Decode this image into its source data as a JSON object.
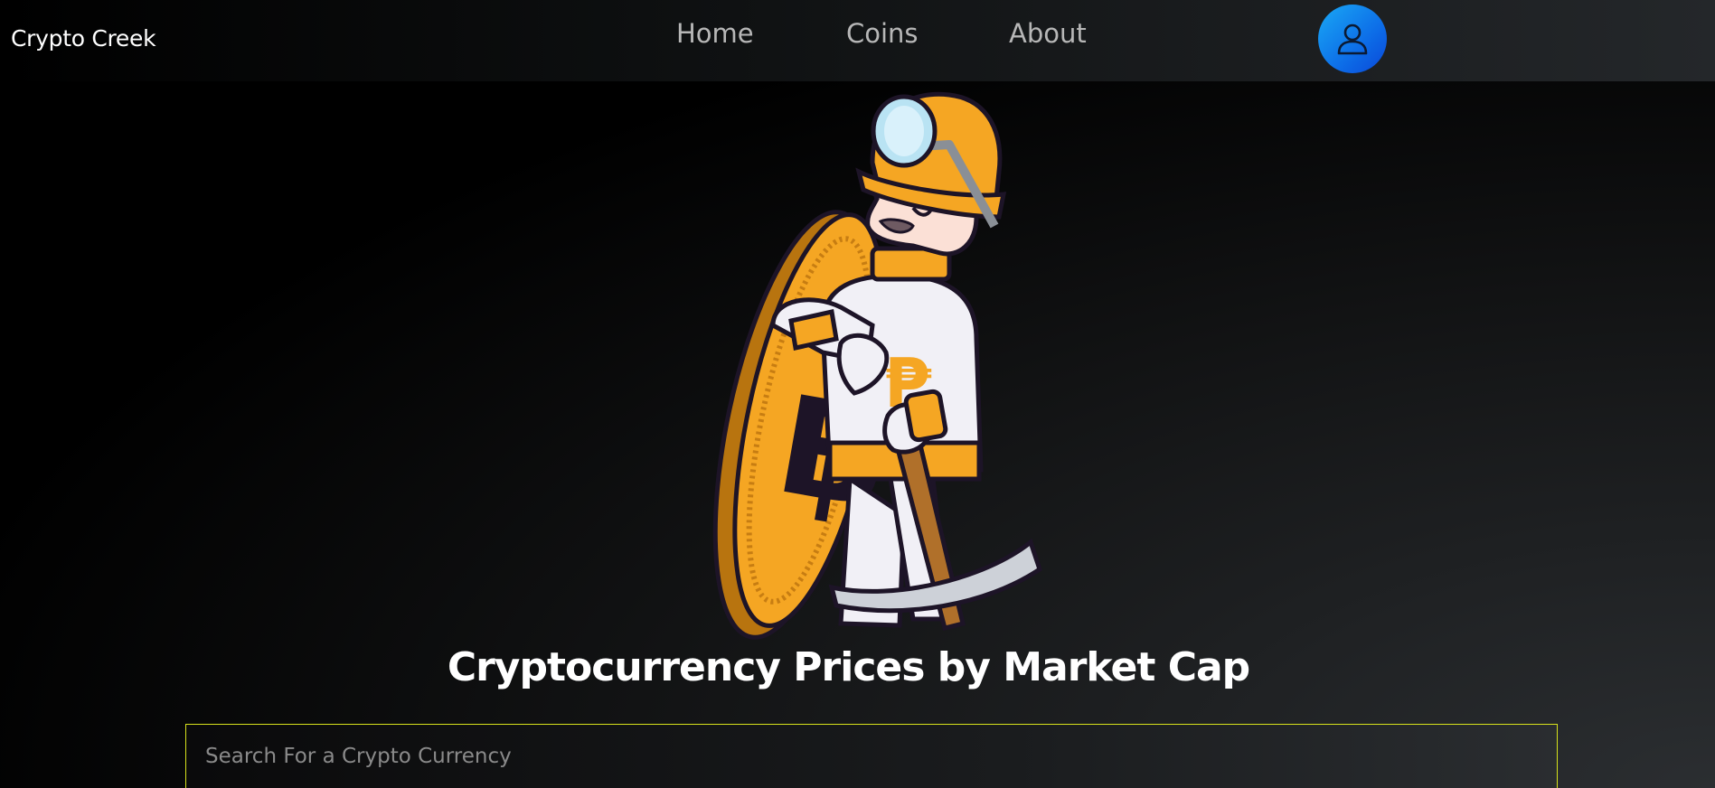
{
  "nav": {
    "brand": "Crypto Creek",
    "links": [
      "Home",
      "Coins",
      "About"
    ],
    "profile_icon": "user-icon"
  },
  "hero": {
    "illustration": "crypto-miner-illustration",
    "title": "Cryptocurrency Prices by Market Cap"
  },
  "search": {
    "placeholder": "Search For a Crypto Currency",
    "value": ""
  },
  "colors": {
    "profile_button": "#0d6ee8",
    "search_border": "#d7e21c",
    "coin_gold": "#f5a623",
    "nav_link": "#b7b7b7"
  }
}
